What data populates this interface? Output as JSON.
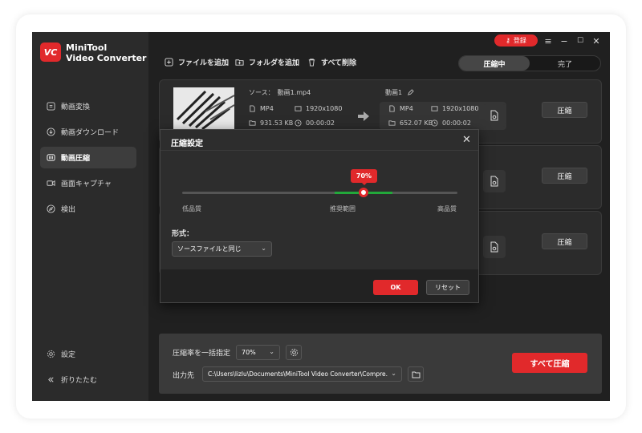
{
  "brand": {
    "line1": "MiniTool",
    "line2": "Video Converter",
    "logo_text": "VC"
  },
  "sidebar": {
    "items": [
      {
        "label": "動画変換",
        "icon": "convert-icon"
      },
      {
        "label": "動画ダウンロード",
        "icon": "download-icon"
      },
      {
        "label": "動画圧縮",
        "icon": "compress-icon",
        "active": true
      },
      {
        "label": "画面キャプチャ",
        "icon": "camera-icon"
      },
      {
        "label": "検出",
        "icon": "compass-icon"
      }
    ],
    "settings_label": "設定",
    "collapse_label": "折りたたむ"
  },
  "titlebar": {
    "login_label": "登録"
  },
  "toolbar": {
    "add_file": "ファイルを追加",
    "add_folder": "フォルダを追加",
    "delete_all": "すべて削除",
    "tab_compressing": "圧縮中",
    "tab_done": "完了"
  },
  "card1": {
    "source_label": "ソース：",
    "source_name": "動画1.mp4",
    "src_format": "MP4",
    "src_resolution": "1920x1080",
    "src_size": "931.53 KB",
    "src_duration": "00:00:02",
    "out_name": "動画1",
    "out_format": "MP4",
    "out_resolution": "1920x1080",
    "out_size": "652.07 KB",
    "out_duration": "00:00:02"
  },
  "card_button_label": "圧縮",
  "dialog": {
    "title": "圧縮設定",
    "slider_value": "70%",
    "slider_fraction": 0.7,
    "low_label": "低品質",
    "recommended_label": "推奨範囲",
    "high_label": "高品質",
    "format_label": "形式：",
    "format_value": "ソースファイルと同じ",
    "ok_label": "OK",
    "reset_label": "リセット"
  },
  "bottom": {
    "rate_label": "圧縮率を一括指定",
    "rate_value": "70%",
    "output_label": "出力先",
    "output_path": "C:\\Users\\lizlu\\Documents\\MiniTool Video Converter\\Compre.",
    "compress_all_label": "すべて圧縮"
  },
  "colors": {
    "accent": "#e1292b",
    "recommended": "#22a83a",
    "background": "#202020",
    "sidebar": "#2b2b2b"
  }
}
